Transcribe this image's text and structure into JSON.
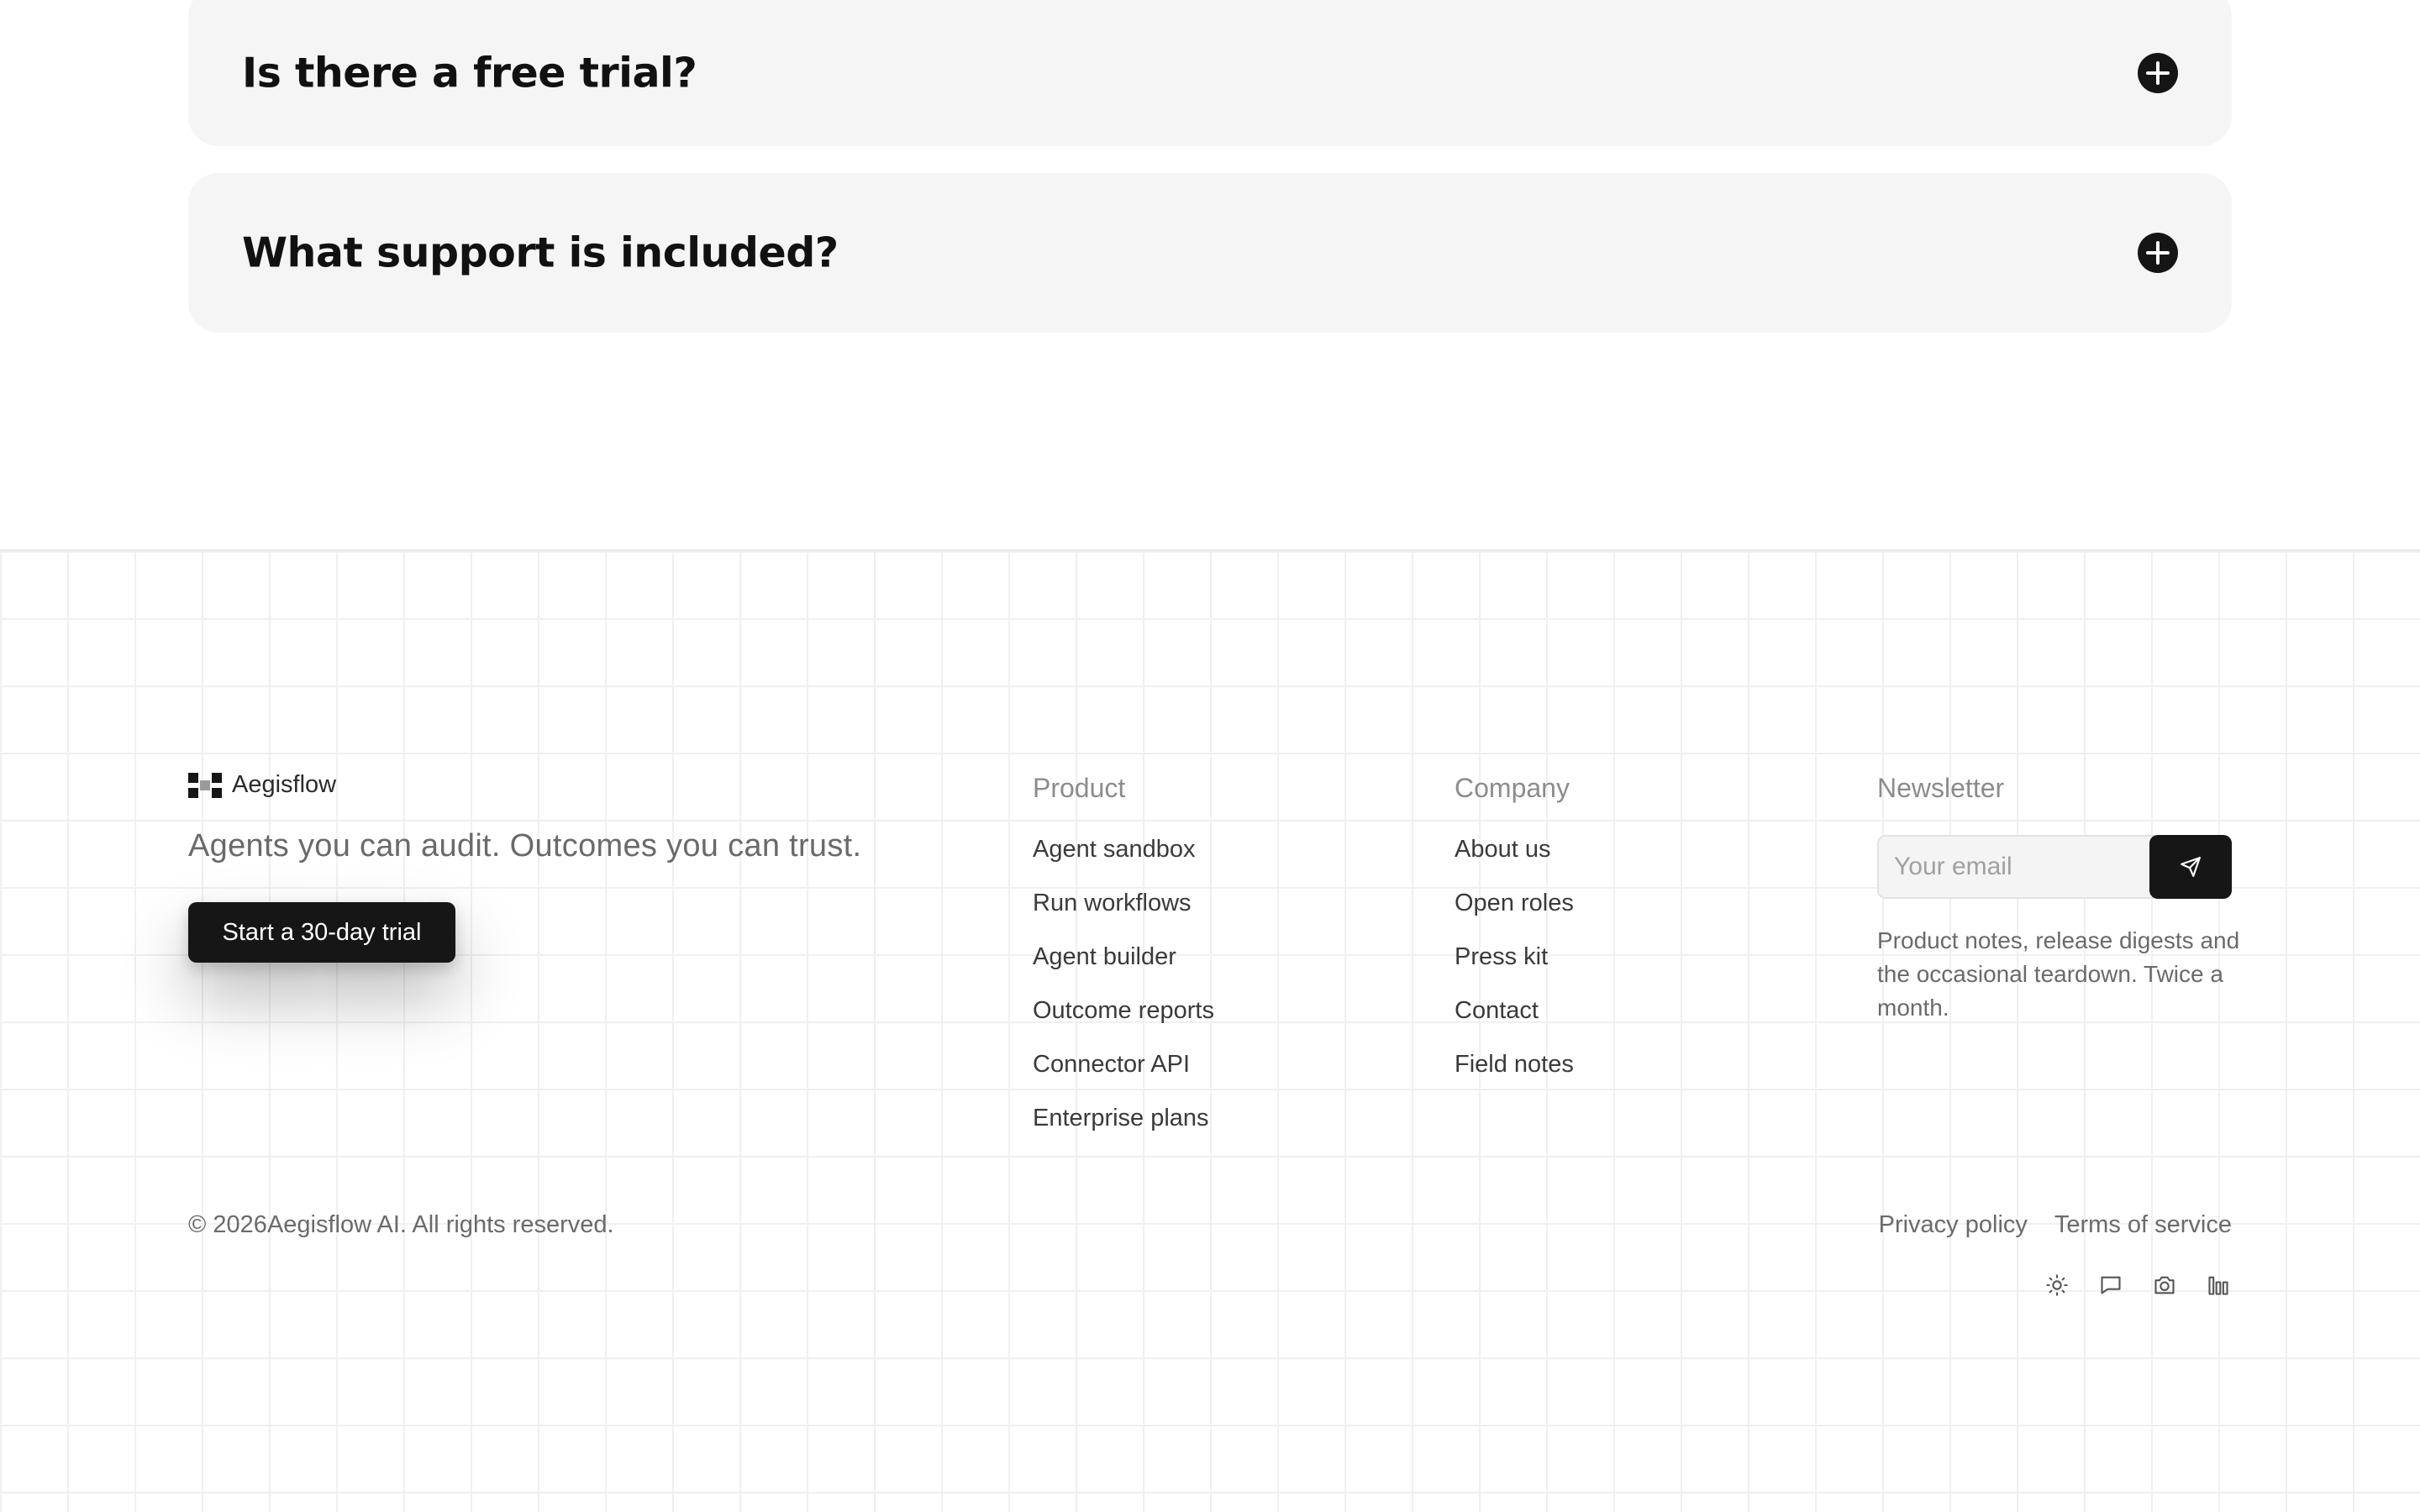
{
  "faq": [
    {
      "question": "Is there a free trial?"
    },
    {
      "question": "What support is included?"
    }
  ],
  "footer": {
    "brand": {
      "name": "Aegisflow"
    },
    "tagline": "Agents you can audit. Outcomes you can trust.",
    "cta_label": "Start a 30-day trial",
    "columns": {
      "product": {
        "title": "Product",
        "links": [
          "Agent sandbox",
          "Run workflows",
          "Agent builder",
          "Outcome reports",
          "Connector API",
          "Enterprise plans"
        ]
      },
      "company": {
        "title": "Company",
        "links": [
          "About us",
          "Open roles",
          "Press kit",
          "Contact",
          "Field notes"
        ]
      }
    },
    "newsletter": {
      "title": "Newsletter",
      "placeholder": "Your email",
      "description": "Product notes, release digests and the occasional teardown. Twice a month."
    },
    "copyright": "© 2026Aegisflow AI. All rights reserved.",
    "legal": {
      "privacy": "Privacy policy",
      "terms": "Terms of service"
    },
    "socials": [
      "sun-icon",
      "chat-icon",
      "camera-icon",
      "bar-chart-icon"
    ]
  },
  "colors": {
    "accent": "#161616",
    "panel": "#f5f5f5",
    "muted_text": "#6a6a6a"
  }
}
